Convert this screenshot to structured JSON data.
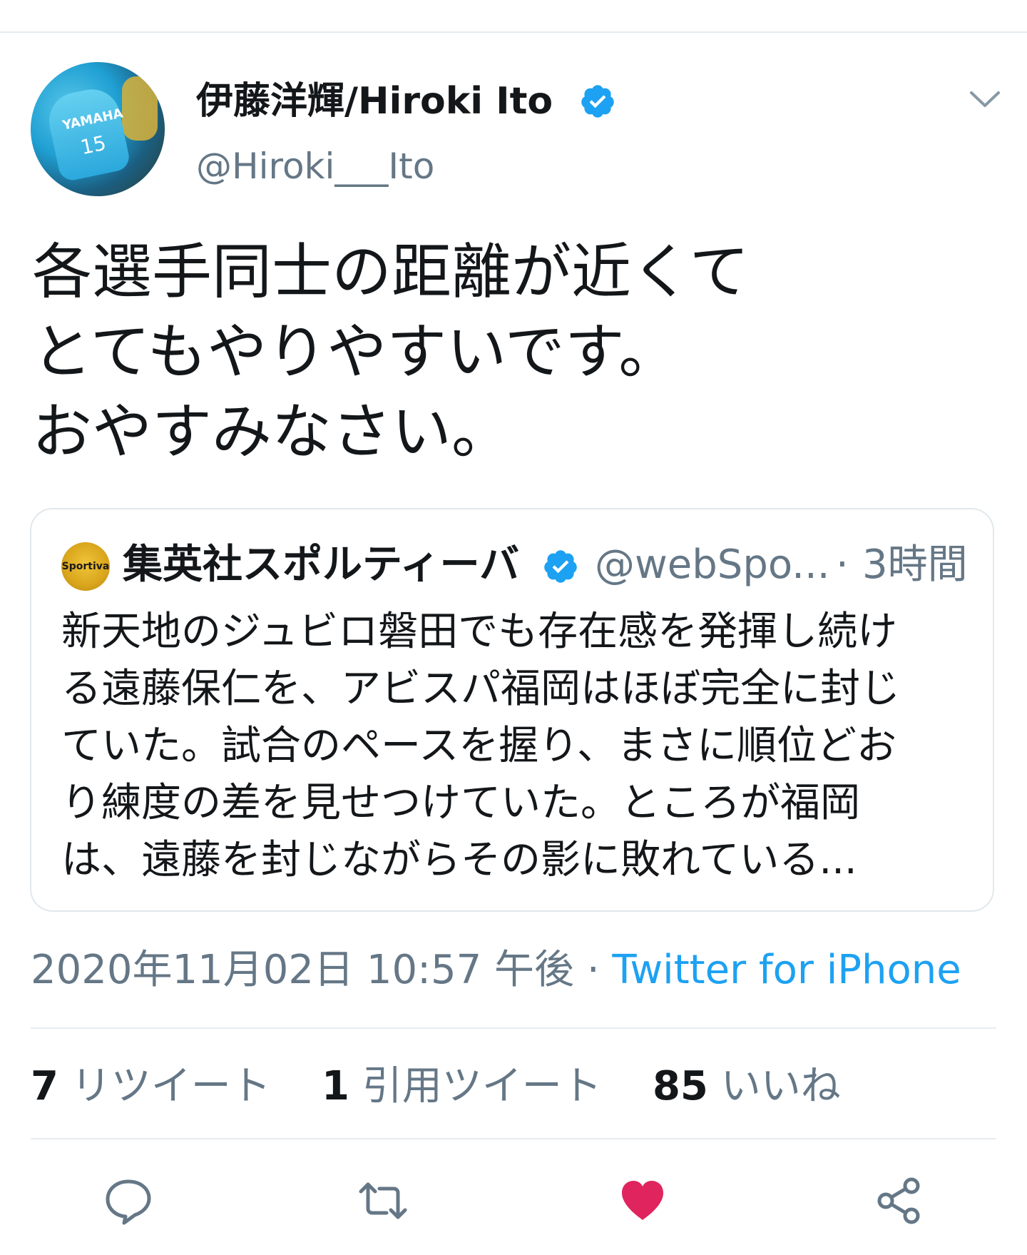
{
  "tweet": {
    "author": {
      "name": "伊藤洋輝/Hiroki Ito",
      "handle": "@Hiroki___Ito",
      "avatar_jersey_text": "YAMAHA",
      "avatar_jersey_number": "15"
    },
    "text": "各選手同士の距離が近くて\nとてもやりやすいです。\nおやすみなさい。",
    "quote": {
      "author_name": "集英社スポルティーバ",
      "handle": "@webSpo...",
      "separator": "·",
      "time": "3時間",
      "avatar_label": "Sportiva",
      "text": "新天地のジュビロ磐田でも存在感を発揮し続け\nる遠藤保仁を、アビスパ福岡はほぼ完全に封じ\nていた。試合のペースを握り、まさに順位どお\nり練度の差を見せつけていた。ところが福岡\nは、遠藤を封じながらその影に敗れている..."
    },
    "meta": {
      "timestamp": "2020年11月02日 10:57 午後",
      "separator": " · ",
      "source": "Twitter for iPhone"
    },
    "stats": {
      "retweets_count": "7",
      "retweets_label": "リツイート",
      "quotes_count": "1",
      "quotes_label": "引用ツイート",
      "likes_count": "85",
      "likes_label": "いいね"
    }
  },
  "icons": {
    "verified": "verified-badge-icon",
    "chevron": "chevron-down-icon",
    "reply": "reply-icon",
    "retweet": "retweet-icon",
    "like": "heart-icon",
    "share": "share-icon"
  },
  "colors": {
    "verified_blue": "#1da1f2",
    "text_primary": "#14171a",
    "text_secondary": "#657786",
    "divider": "#e6ecf0",
    "like_red": "#e0245e",
    "source_link": "#1da1f2"
  },
  "state": {
    "liked": true
  }
}
